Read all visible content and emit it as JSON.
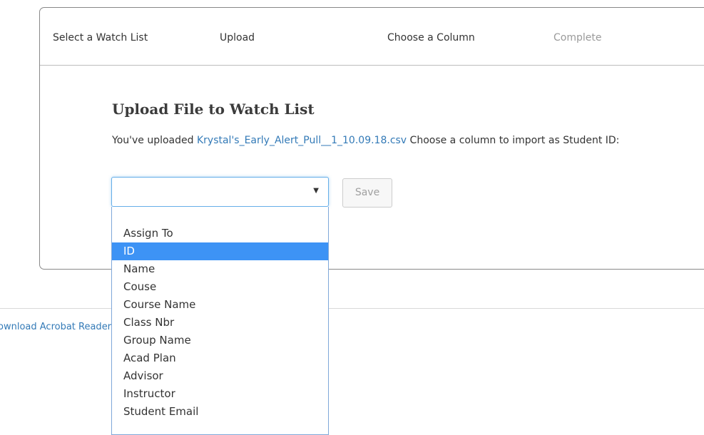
{
  "wizard": {
    "steps": [
      {
        "label": "Select a Watch List",
        "state": "done"
      },
      {
        "label": "Upload",
        "state": "done"
      },
      {
        "label": "Choose a Column",
        "state": "active"
      },
      {
        "label": "Complete",
        "state": "pending"
      }
    ]
  },
  "main": {
    "heading": "Upload File to Watch List",
    "message_prefix": "You've uploaded ",
    "file_name": "Krystal's_Early_Alert_Pull__1_10.09.18.csv",
    "message_suffix": " Choose a column to import as Student ID:",
    "select_value": "",
    "save_label": "Save"
  },
  "dropdown": {
    "options": [
      "Assign To",
      "ID",
      "Name",
      "Couse",
      "Course Name",
      "Class Nbr",
      "Group Name",
      "Acad Plan",
      "Advisor",
      "Instructor",
      "Student Email"
    ],
    "highlighted": "ID"
  },
  "footer": {
    "link_text": "Download Acrobat Reader"
  },
  "colors": {
    "link": "#337ab7",
    "highlight": "#3d93f5",
    "muted_step": "#9a9a9a"
  }
}
